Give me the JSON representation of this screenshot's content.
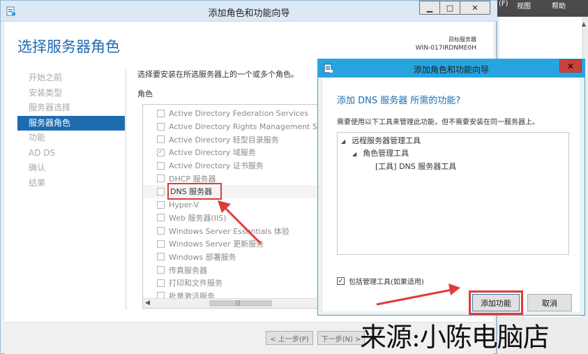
{
  "main_window": {
    "title": "添加角色和功能向导",
    "controls": {
      "minimize": "▁",
      "maximize": "□",
      "close": "✕"
    },
    "page_heading": "选择服务器角色",
    "target_server_label": "目标服务器",
    "target_server_value": "WIN-017IRDNME0H",
    "nav": [
      {
        "label": "开始之前",
        "active": false
      },
      {
        "label": "安装类型",
        "active": false
      },
      {
        "label": "服务器选择",
        "active": false
      },
      {
        "label": "服务器角色",
        "active": true
      },
      {
        "label": "功能",
        "active": false
      },
      {
        "label": "AD DS",
        "active": false
      },
      {
        "label": "确认",
        "active": false
      },
      {
        "label": "结果",
        "active": false
      }
    ],
    "description": "选择要安装在所选服务器上的一个或多个角色。",
    "roles_label": "角色",
    "roles": [
      {
        "label": "Active Directory Federation Services",
        "checked": false
      },
      {
        "label": "Active Directory Rights Management Servic",
        "checked": false
      },
      {
        "label": "Active Directory 轻型目录服务",
        "checked": false
      },
      {
        "label": "Active Directory 域服务",
        "checked": true
      },
      {
        "label": "Active Directory 证书服务",
        "checked": false
      },
      {
        "label": "DHCP 服务器",
        "checked": false
      },
      {
        "label": "DNS 服务器",
        "checked": false
      },
      {
        "label": "Hyper-V",
        "checked": false
      },
      {
        "label": "Web 服务器(IIS)",
        "checked": false
      },
      {
        "label": "Windows Server Essentials 体验",
        "checked": false
      },
      {
        "label": "Windows Server 更新服务",
        "checked": false
      },
      {
        "label": "Windows 部署服务",
        "checked": false
      },
      {
        "label": "传真服务器",
        "checked": false
      },
      {
        "label": "打印和文件服务",
        "checked": false
      },
      {
        "label": "批量激活服务",
        "checked": false
      }
    ],
    "buttons": {
      "prev": "< 上一步(P)",
      "next": "下一步(N) >"
    }
  },
  "dialog": {
    "title": "添加角色和功能向导",
    "close": "✕",
    "heading": "添加 DNS 服务器 所需的功能?",
    "description": "需要使用以下工具来管理此功能，但不需要安装在同一服务器上。",
    "tree": [
      {
        "label": "远程服务器管理工具",
        "level": 0,
        "twisty": "◢"
      },
      {
        "label": "角色管理工具",
        "level": 1,
        "twisty": "◢"
      },
      {
        "label": "[工具] DNS 服务器工具",
        "level": 2,
        "twisty": ""
      }
    ],
    "include_tools_label": "包括管理工具(如果适用)",
    "include_tools_checked": true,
    "add_button": "添加功能",
    "cancel_button": "取消"
  },
  "background": {
    "top_labels": [
      "(F)",
      "视图",
      "帮助"
    ]
  },
  "annotations": {
    "highlight_color": "#e03a3a",
    "accent_color": "#1e6bb0",
    "dialog_title_color": "#28a4de"
  },
  "watermark": "来源:小陈电脑店"
}
